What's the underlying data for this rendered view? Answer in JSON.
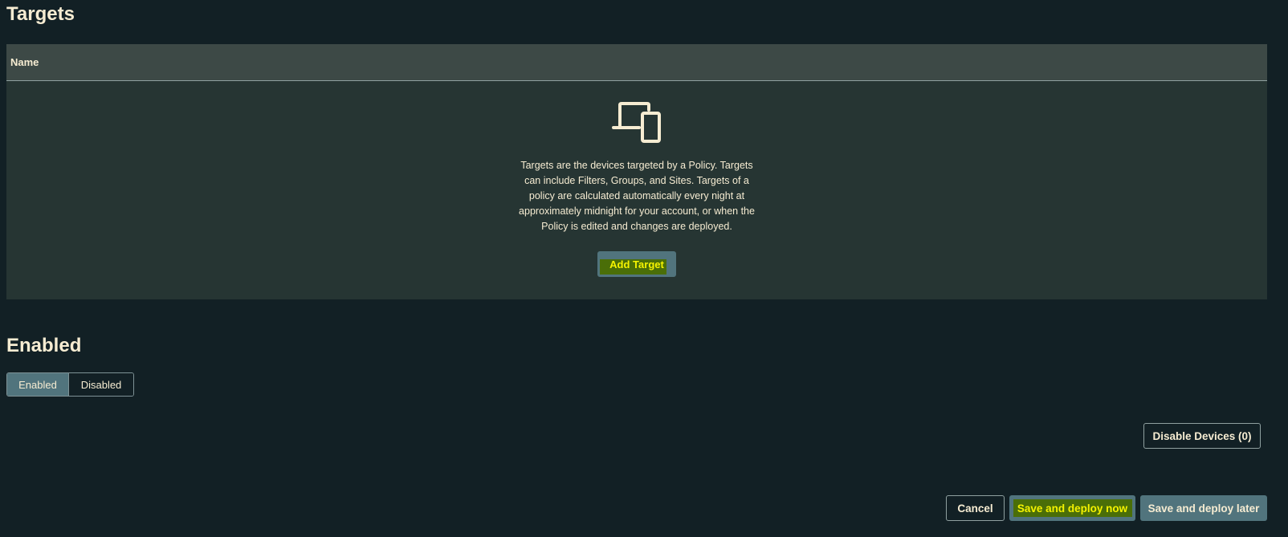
{
  "targets": {
    "title": "Targets",
    "table_header": "Name",
    "empty_text": "Targets are the devices targeted by a Policy. Targets can include Filters, Groups, and Sites. Targets of a policy are calculated automatically every night at approximately midnight for your account, or when the Policy is edited and changes are deployed.",
    "empty_icon": "devices-icon",
    "add_button": "Add Target"
  },
  "enabled": {
    "title": "Enabled",
    "options": [
      "Enabled",
      "Disabled"
    ],
    "selected": "Enabled"
  },
  "actions": {
    "disable_devices": "Disable Devices (0)",
    "cancel": "Cancel",
    "save_now": "Save and deploy now",
    "save_later": "Save and deploy later"
  },
  "colors": {
    "background": "#122025",
    "table_body": "#263533",
    "table_header": "#3d4946",
    "primary_button": "#51747d",
    "highlight": "#4a6e08",
    "highlight_text": "#f5f300",
    "text": "#f6ecd2"
  }
}
